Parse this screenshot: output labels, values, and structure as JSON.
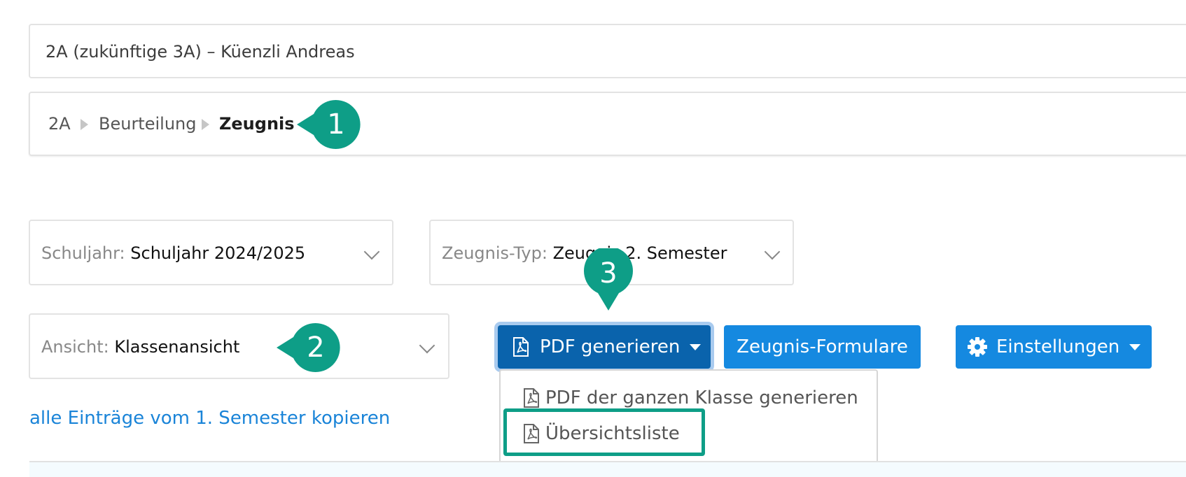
{
  "class_select": {
    "value": "2A (zukünftige 3A) – Küenzli Andreas"
  },
  "breadcrumb": {
    "items": [
      "2A",
      "Beurteilung",
      "Zeugnis"
    ]
  },
  "filters": {
    "schuljahr": {
      "label": "Schuljahr:",
      "value": "Schuljahr 2024/2025"
    },
    "zeugnis_typ": {
      "label": "Zeugnis-Typ:",
      "value": "Zeugnis 2. Semester"
    },
    "ansicht": {
      "label": "Ansicht:",
      "value": "Klassenansicht"
    }
  },
  "buttons": {
    "pdf": "PDF generieren",
    "forms": "Zeugnis-Formulare",
    "settings": "Einstellungen"
  },
  "pdf_menu": {
    "items": [
      "PDF der ganzen Klasse generieren",
      "Übersichtsliste"
    ]
  },
  "copy_link": "alle Einträge vom 1. Semester kopieren",
  "annotations": {
    "marker_1": "1",
    "marker_2": "2",
    "marker_3": "3"
  },
  "colors": {
    "primary": "#1589e0",
    "primary_active": "#0a63ac",
    "annotation": "#0e9e87",
    "link": "#1a84d8"
  }
}
